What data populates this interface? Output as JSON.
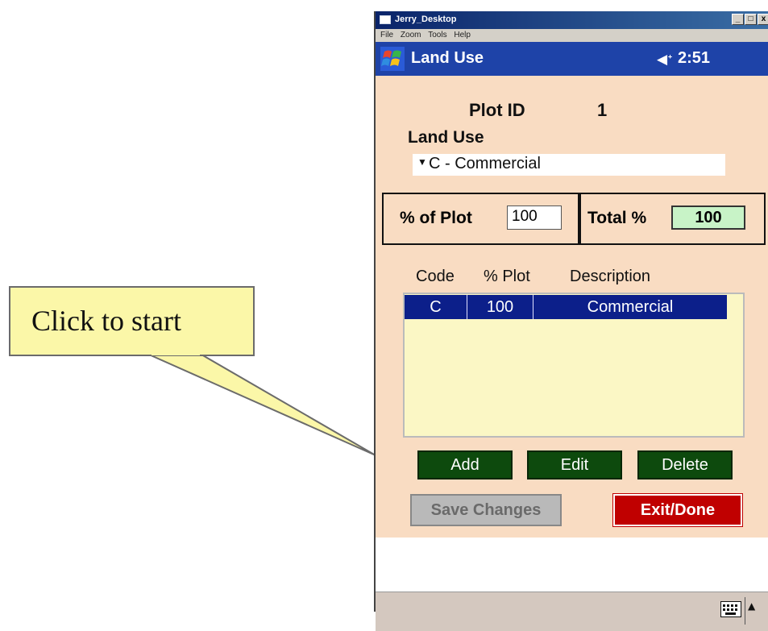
{
  "callout": {
    "text": "Click to start"
  },
  "window": {
    "title": "Jerry_Desktop",
    "controls": {
      "minimize": "_",
      "maximize": "□",
      "close": "x"
    },
    "menu": [
      "File",
      "Zoom",
      "Tools",
      "Help"
    ]
  },
  "ppc": {
    "title": "Land Use",
    "speaker_icon": "speaker-icon",
    "time": "2:51"
  },
  "form": {
    "plot_id_label": "Plot ID",
    "plot_id_value": "1",
    "land_use_label": "Land Use",
    "land_use_selected": "C - Commercial",
    "pct_of_plot_label": "% of Plot",
    "pct_of_plot_value": "100",
    "total_label": "Total %",
    "total_value": "100",
    "columns": [
      "Code",
      "% Plot",
      "Description"
    ],
    "rows": [
      {
        "code": "C",
        "pct": "100",
        "description": "Commercial"
      }
    ],
    "buttons": {
      "add": "Add",
      "edit": "Edit",
      "delete": "Delete",
      "save": "Save Changes",
      "exit": "Exit/Done"
    }
  },
  "colors": {
    "form_bg": "#f9dcc2",
    "header_blue": "#1e43a8",
    "selected_row": "#0c1f8a",
    "button_green": "#0d4a0d",
    "exit_red": "#c00000",
    "total_bg": "#c8f3c7",
    "callout_bg": "#fbf7a8"
  }
}
